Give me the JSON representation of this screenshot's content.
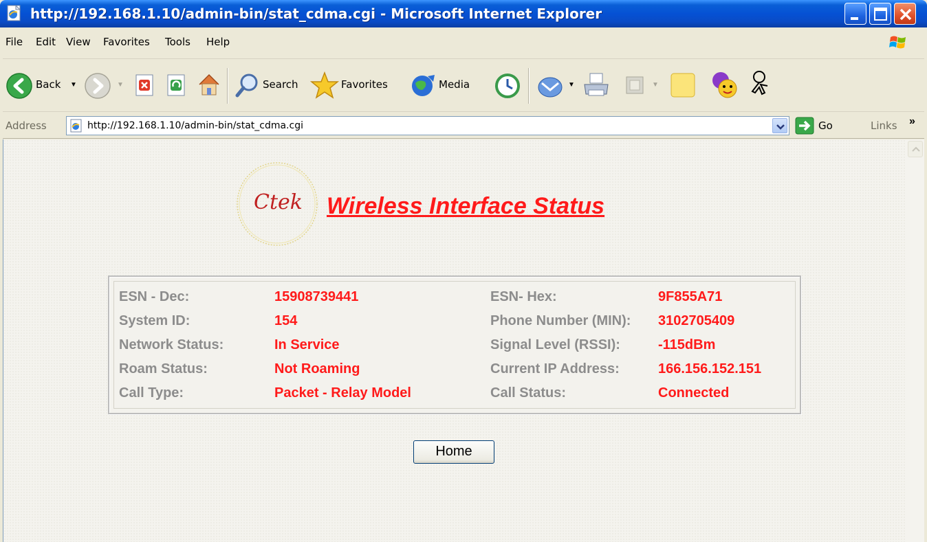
{
  "window": {
    "title": "http://192.168.1.10/admin-bin/stat_cdma.cgi - Microsoft Internet Explorer",
    "app_icon": "ie-page-icon",
    "controls": [
      "minimize-icon",
      "maximize-icon",
      "close-icon"
    ]
  },
  "menu": {
    "items": [
      "File",
      "Edit",
      "View",
      "Favorites",
      "Tools",
      "Help"
    ]
  },
  "toolbar": {
    "back_label": "Back",
    "search_label": "Search",
    "favorites_label": "Favorites",
    "media_label": "Media"
  },
  "address": {
    "label": "Address",
    "url": "http://192.168.1.10/admin-bin/stat_cdma.cgi",
    "go_label": "Go",
    "links_label": "Links",
    "links_chevron": "»"
  },
  "page": {
    "logo_text": "Ctek",
    "title": "Wireless Interface Status",
    "home_button": "Home",
    "status": {
      "left": [
        {
          "label": "ESN - Dec:",
          "value": "15908739441"
        },
        {
          "label": "System ID:",
          "value": "154"
        },
        {
          "label": "Network Status:",
          "value": "In Service"
        },
        {
          "label": "Roam Status:",
          "value": "Not Roaming"
        },
        {
          "label": "Call Type:",
          "value": "Packet - Relay Model"
        }
      ],
      "right": [
        {
          "label": "ESN- Hex:",
          "value": "9F855A71"
        },
        {
          "label": "Phone Number (MIN):",
          "value": "3102705409"
        },
        {
          "label": "Signal Level (RSSI):",
          "value": "-115dBm"
        },
        {
          "label": "Current IP Address:",
          "value": "166.156.152.151"
        },
        {
          "label": "Call Status:",
          "value": "Connected"
        }
      ]
    }
  },
  "colors": {
    "titlebar": "#0551d4",
    "label_gray": "#8c8c8c",
    "value_red": "#ff1a1a"
  }
}
